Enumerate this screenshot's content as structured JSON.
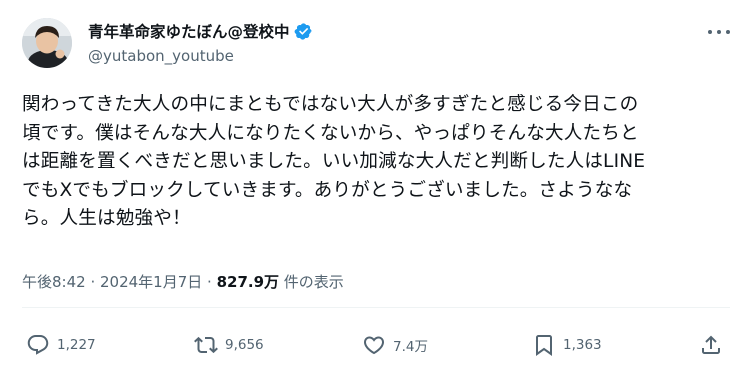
{
  "user": {
    "display_name": "青年革命家ゆたぼん@登校中",
    "handle": "@yutabon_youtube"
  },
  "tweet": {
    "text": "関わってきた大人の中にまともではない大人が多すぎたと感じる今日この\n頃です。僕はそんな大人になりたくないから、やっぱりそんな大人たちと\nは距離を置くべきだと思いました。いい加減な大人だと判断した人はLINE\nでもXでもブロックしていきます。ありがとうございました。さようなな\nら。人生は勉強や！"
  },
  "meta": {
    "time": "午後8:42",
    "separator": " · ",
    "date": "2024年1月7日",
    "separator2": " · ",
    "views": "827.9万",
    "views_label": " 件の表示"
  },
  "actions": {
    "reply_count": "1,227",
    "repost_count": "9,656",
    "like_count": "7.4万",
    "bookmark_count": "1,363"
  },
  "icons": {
    "verified": "verified-badge-icon",
    "more": "more-icon",
    "reply": "reply-icon",
    "repost": "repost-icon",
    "like": "heart-icon",
    "bookmark": "bookmark-icon",
    "share": "share-icon"
  },
  "colors": {
    "verified": "#1d9bf0",
    "secondary_text": "#536471",
    "primary_text": "#0f1419"
  }
}
